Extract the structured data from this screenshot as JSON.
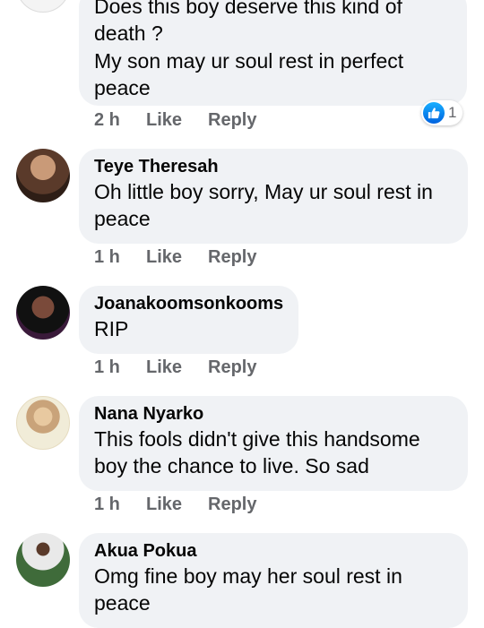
{
  "colors": {
    "bubble_bg": "#f0f2f5",
    "action_text": "#65676b",
    "like_blue": "#1877f2"
  },
  "comments": [
    {
      "name": "",
      "text": "Does this boy deserve this kind of death ?",
      "text2": "My son may ur soul rest in perfect peace",
      "time": "2 h",
      "like": "Like",
      "reply": "Reply",
      "reaction_icon": "like-reaction-icon",
      "reaction_count": "1"
    },
    {
      "name": "Teye Theresah",
      "text": "Oh little  boy sorry, May ur soul rest in peace",
      "time": "1 h",
      "like": "Like",
      "reply": "Reply"
    },
    {
      "name": "Joanakoomsonkooms",
      "text": "RIP",
      "time": "1 h",
      "like": "Like",
      "reply": "Reply"
    },
    {
      "name": "Nana Nyarko",
      "text": "This fools didn't give this handsome boy the chance to live. So sad",
      "time": "1 h",
      "like": "Like",
      "reply": "Reply"
    },
    {
      "name": "Akua Pokua",
      "text": "Omg fine boy may her soul rest in peace"
    }
  ]
}
